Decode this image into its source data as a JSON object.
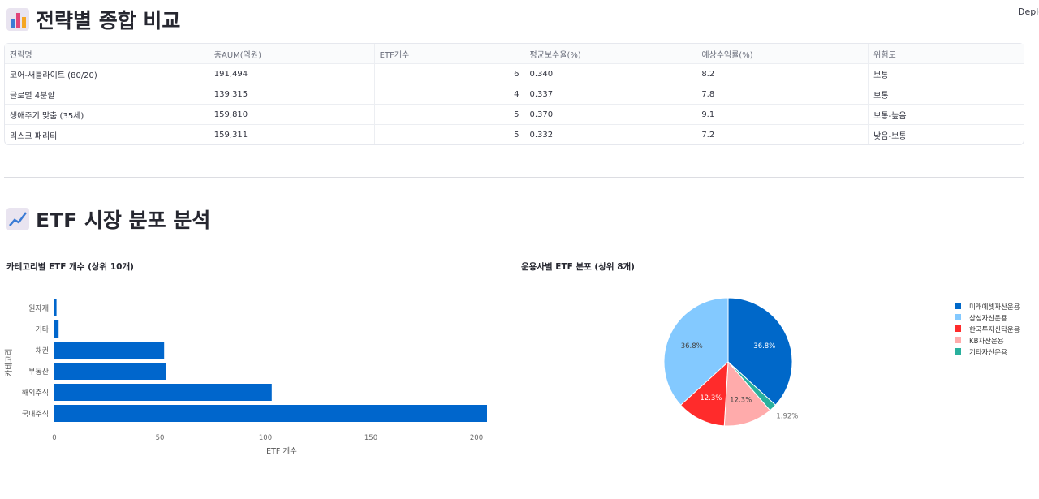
{
  "header": {
    "deploy_label": "Deploy"
  },
  "section1": {
    "title": "전략별 종합 비교"
  },
  "table": {
    "columns": [
      "전략명",
      "총AUM(억원)",
      "ETF개수",
      "평균보수율(%)",
      "예상수익률(%)",
      "위험도"
    ],
    "rows": [
      [
        "코어-새틀라이트 (80/20)",
        "191,494",
        "6",
        "0.340",
        "8.2",
        "보통"
      ],
      [
        "글로벌 4분할",
        "139,315",
        "4",
        "0.337",
        "7.8",
        "보통"
      ],
      [
        "생애주기 맞춤 (35세)",
        "159,810",
        "5",
        "0.370",
        "9.1",
        "보통-높음"
      ],
      [
        "리스크 패리티",
        "159,311",
        "5",
        "0.332",
        "7.2",
        "낮음-보통"
      ]
    ]
  },
  "section2": {
    "title": "ETF 시장 분포 분석"
  },
  "chart_data": [
    {
      "type": "bar",
      "orientation": "horizontal",
      "title": "카테고리별 ETF 개수 (상위 10개)",
      "categories": [
        "원자재",
        "기타",
        "채권",
        "부동산",
        "해외주식",
        "국내주식"
      ],
      "values": [
        1,
        2,
        52,
        53,
        103,
        205
      ],
      "xlabel": "ETF 개수",
      "ylabel": "카테고리",
      "xlim": [
        0,
        205
      ],
      "xticks": [
        "0",
        "50",
        "100",
        "150",
        "200"
      ],
      "color": "#0066cc"
    },
    {
      "type": "pie",
      "title": "운용사별 ETF 분포 (상위 8개)",
      "labels": [
        "미래에셋자산운용",
        "삼성자산운용",
        "한국투자신탁운용",
        "KB자산운용",
        "기타자산운용"
      ],
      "values": [
        36.8,
        36.8,
        12.3,
        12.3,
        1.92
      ],
      "value_labels": [
        "36.8%",
        "36.8%",
        "12.3%",
        "12.3%",
        "1.92%"
      ],
      "colors": [
        "#0068c9",
        "#83c9ff",
        "#ff2b2b",
        "#ffabab",
        "#29b09d"
      ],
      "draw_order": [
        0,
        4,
        3,
        2,
        1
      ],
      "legend": "right"
    }
  ]
}
